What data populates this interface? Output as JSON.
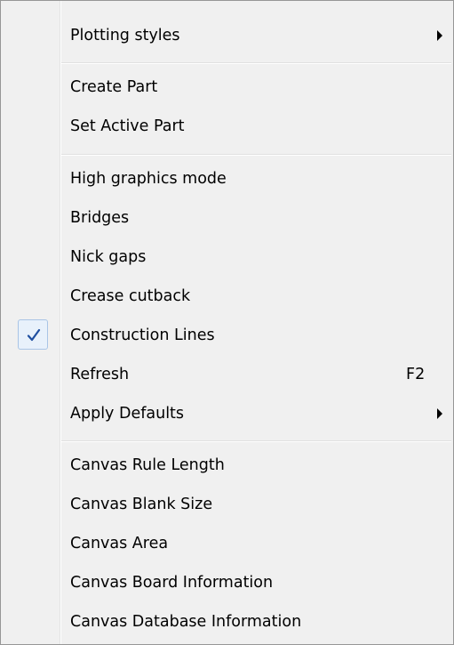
{
  "menu": {
    "plotting_styles": "Plotting styles",
    "create_part": "Create Part",
    "set_active_part": "Set Active Part",
    "high_graphics_mode": "High graphics mode",
    "bridges": "Bridges",
    "nick_gaps": "Nick gaps",
    "crease_cutback": "Crease cutback",
    "construction_lines": "Construction Lines",
    "construction_lines_checked": true,
    "refresh": "Refresh",
    "refresh_shortcut": "F2",
    "apply_defaults": "Apply Defaults",
    "canvas_rule_length": "Canvas Rule Length",
    "canvas_blank_size": "Canvas Blank Size",
    "canvas_area": "Canvas Area",
    "canvas_board_information": "Canvas Board Information",
    "canvas_database_information": "Canvas Database Information"
  },
  "icons": {
    "submenu": "chevron-right-icon",
    "check": "checkmark-icon"
  },
  "colors": {
    "background": "#f0f0f0",
    "border": "#979797",
    "check": "#1f4fa0",
    "check_box_fill": "#e8f1fb",
    "check_box_border": "#a9c4e6"
  }
}
